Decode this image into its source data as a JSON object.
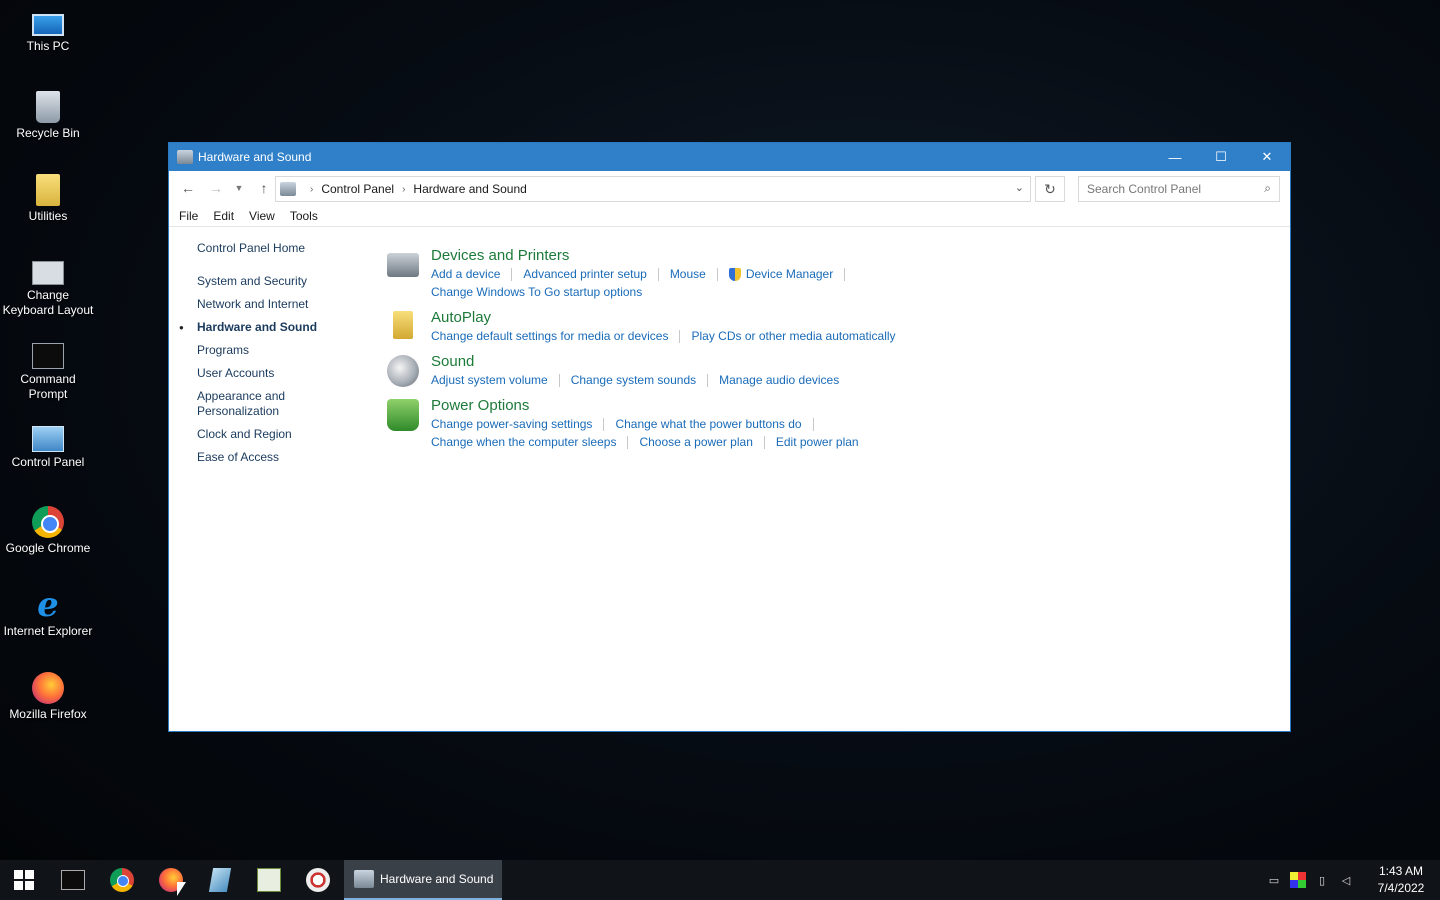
{
  "desktop": {
    "icons": [
      {
        "label": "This PC",
        "icon": "computer-icon"
      },
      {
        "label": "Recycle Bin",
        "icon": "recycle-bin-icon"
      },
      {
        "label": "Utilities",
        "icon": "folder-icon"
      },
      {
        "label": "Change Keyboard Layout",
        "icon": "keyboard-layout-icon"
      },
      {
        "label": "Command Prompt",
        "icon": "command-prompt-icon"
      },
      {
        "label": "Control Panel",
        "icon": "control-panel-icon"
      },
      {
        "label": "Google Chrome",
        "icon": "chrome-icon"
      },
      {
        "label": "Internet Explorer",
        "icon": "internet-explorer-icon"
      },
      {
        "label": "Mozilla Firefox",
        "icon": "firefox-icon"
      }
    ]
  },
  "window": {
    "title": "Hardware and Sound",
    "buttons": {
      "minimize": "—",
      "maximize": "☐",
      "close": "✕"
    }
  },
  "address": {
    "crumbs": [
      "Control Panel",
      "Hardware and Sound"
    ],
    "search_placeholder": "Search Control Panel"
  },
  "menu": [
    "File",
    "Edit",
    "View",
    "Tools"
  ],
  "sidebar": {
    "home": "Control Panel Home",
    "items": [
      "System and Security",
      "Network and Internet",
      "Hardware and Sound",
      "Programs",
      "User Accounts",
      "Appearance and Personalization",
      "Clock and Region",
      "Ease of Access"
    ],
    "active": "Hardware and Sound"
  },
  "sections": {
    "devices": {
      "title": "Devices and Printers",
      "links": [
        "Add a device",
        "Advanced printer setup",
        "Mouse",
        "Device Manager",
        "Change Windows To Go startup options"
      ]
    },
    "autoplay": {
      "title": "AutoPlay",
      "links": [
        "Change default settings for media or devices",
        "Play CDs or other media automatically"
      ]
    },
    "sound": {
      "title": "Sound",
      "links": [
        "Adjust system volume",
        "Change system sounds",
        "Manage audio devices"
      ]
    },
    "power": {
      "title": "Power Options",
      "links": [
        "Change power-saving settings",
        "Change what the power buttons do",
        "Change when the computer sleeps",
        "Choose a power plan",
        "Edit power plan"
      ]
    }
  },
  "taskbar": {
    "active_task": "Hardware and Sound",
    "clock_time": "1:43 AM",
    "clock_date": "7/4/2022"
  },
  "colors": {
    "titlebar": "#2f7fc9",
    "link": "#1a6bb8",
    "section_title": "#1e7a3a"
  }
}
